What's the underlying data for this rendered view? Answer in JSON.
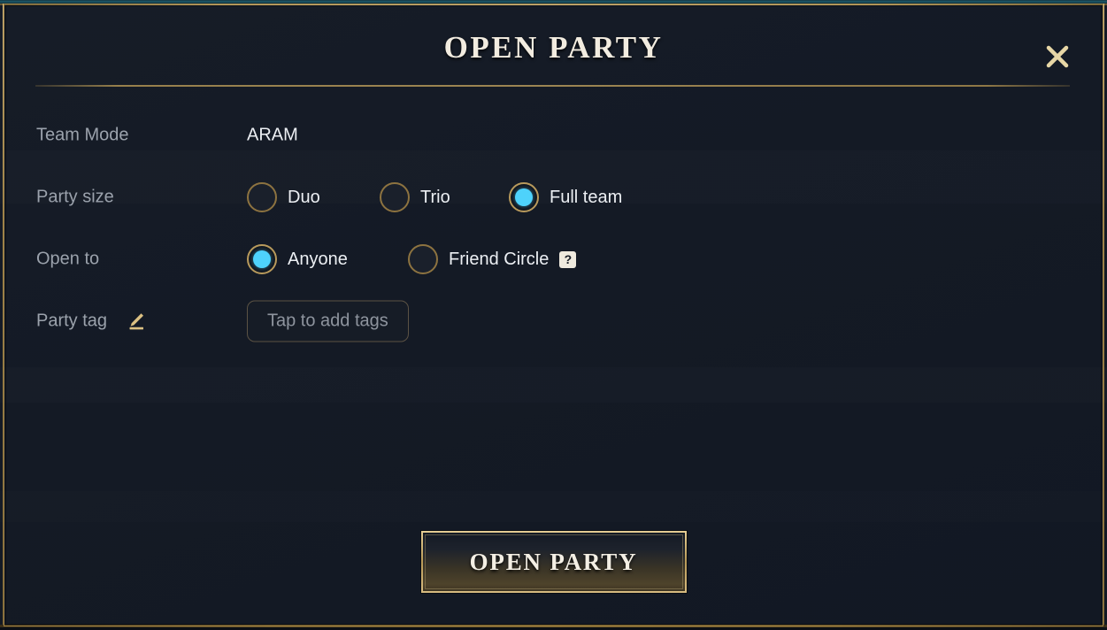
{
  "window": {
    "title": "OPEN PARTY",
    "close_icon": "close-icon"
  },
  "theme": {
    "accent_gold": "#b89a5c",
    "accent_cyan": "#4ed2fb",
    "background": "#141a25",
    "label_color": "#9ba2ac",
    "value_color": "#eceff3"
  },
  "form": {
    "team_mode": {
      "label": "Team Mode",
      "value": "ARAM"
    },
    "party_size": {
      "label": "Party size",
      "options": [
        {
          "label": "Duo",
          "selected": false
        },
        {
          "label": "Trio",
          "selected": false
        },
        {
          "label": "Full team",
          "selected": true
        }
      ]
    },
    "open_to": {
      "label": "Open to",
      "options": [
        {
          "label": "Anyone",
          "selected": true
        },
        {
          "label": "Friend Circle",
          "selected": false,
          "help_badge": "?"
        }
      ]
    },
    "party_tag": {
      "label": "Party tag",
      "edit_icon": "pencil-icon",
      "tag_button_label": "Tap to add tags"
    }
  },
  "footer": {
    "primary_button": "OPEN PARTY"
  }
}
